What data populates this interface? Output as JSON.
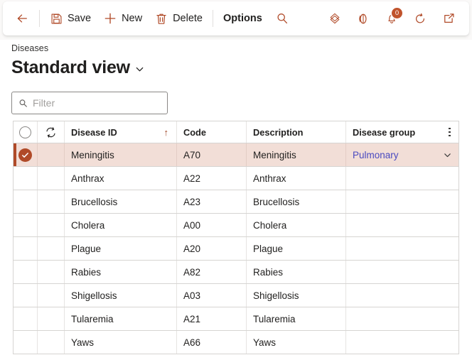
{
  "theme": {
    "accent": "#b04a28",
    "badge_bg": "#c0532c",
    "selected_row_bg": "#f2ded7",
    "link": "#4a4ac0",
    "cmdbar_bg": "#faf9f8",
    "grid_border": "#d6d4d2"
  },
  "commandbar": {
    "back_icon": "arrow-left-icon",
    "buttons": [
      {
        "id": "save",
        "label": "Save",
        "icon": "save-icon"
      },
      {
        "id": "new",
        "label": "New",
        "icon": "plus-icon"
      },
      {
        "id": "delete",
        "label": "Delete",
        "icon": "trash-icon"
      },
      {
        "id": "options",
        "label": "Options",
        "icon": ""
      }
    ],
    "search_icon": "search-icon",
    "right_icons": [
      {
        "id": "power-apps",
        "icon": "diamond-icon",
        "badge": ""
      },
      {
        "id": "help",
        "icon": "half-circle-icon",
        "badge": ""
      },
      {
        "id": "notifications",
        "icon": "bell-icon",
        "badge": "0"
      },
      {
        "id": "refresh",
        "icon": "refresh-icon",
        "badge": ""
      },
      {
        "id": "open-new",
        "icon": "open-in-new-icon",
        "badge": ""
      }
    ]
  },
  "header": {
    "breadcrumb": "Diseases",
    "title": "Standard view",
    "title_chevron_icon": "chevron-down-icon"
  },
  "filter": {
    "icon": "search-icon",
    "placeholder": "Filter",
    "value": ""
  },
  "grid": {
    "select_all_icon": "circle-icon",
    "row_icon": "sync-icon",
    "kebab_icon": "more-vertical-icon",
    "sort_arrow": "↑",
    "columns": [
      {
        "key": "id",
        "label": "Disease ID",
        "sorted": "asc"
      },
      {
        "key": "code",
        "label": "Code",
        "sorted": ""
      },
      {
        "key": "desc",
        "label": "Description",
        "sorted": ""
      },
      {
        "key": "group",
        "label": "Disease group",
        "sorted": ""
      }
    ],
    "rows": [
      {
        "id": "Meningitis",
        "code": "A70",
        "desc": "Meningitis",
        "group": "Pulmonary",
        "selected": true
      },
      {
        "id": "Anthrax",
        "code": "A22",
        "desc": "Anthrax",
        "group": "",
        "selected": false
      },
      {
        "id": "Brucellosis",
        "code": "A23",
        "desc": "Brucellosis",
        "group": "",
        "selected": false
      },
      {
        "id": "Cholera",
        "code": "A00",
        "desc": "Cholera",
        "group": "",
        "selected": false
      },
      {
        "id": "Plague",
        "code": "A20",
        "desc": "Plague",
        "group": "",
        "selected": false
      },
      {
        "id": "Rabies",
        "code": "A82",
        "desc": "Rabies",
        "group": "",
        "selected": false
      },
      {
        "id": "Shigellosis",
        "code": "A03",
        "desc": "Shigellosis",
        "group": "",
        "selected": false
      },
      {
        "id": "Tularemia",
        "code": "A21",
        "desc": "Tularemia",
        "group": "",
        "selected": false
      },
      {
        "id": "Yaws",
        "code": "A66",
        "desc": "Yaws",
        "group": "",
        "selected": false
      }
    ]
  }
}
